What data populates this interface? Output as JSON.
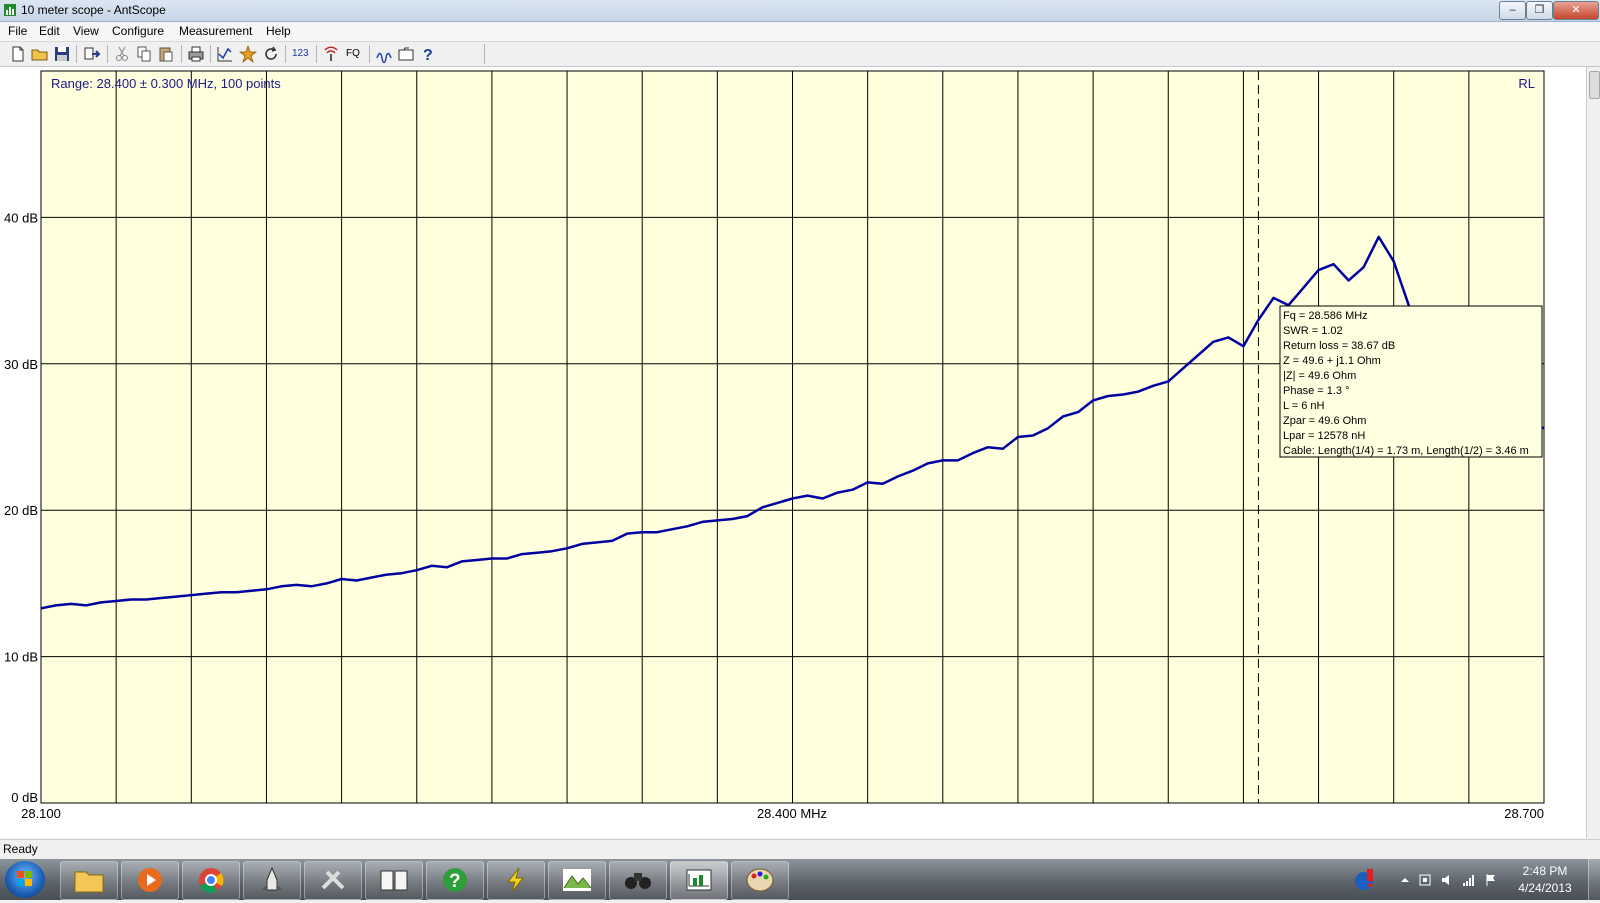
{
  "window": {
    "title": "10 meter scope - AntScope",
    "minimize_label": "–",
    "restore_label": "❐",
    "close_label": "✕"
  },
  "menu": [
    "File",
    "Edit",
    "View",
    "Configure",
    "Measurement",
    "Help"
  ],
  "toolbar": {
    "icons": [
      "new-file-icon",
      "open-folder-icon",
      "save-icon",
      "export-icon",
      "cut-icon",
      "copy-icon",
      "paste-icon",
      "print-icon",
      "graph-icon",
      "star-icon",
      "refresh-icon",
      "numbers-icon",
      "antenna-icon",
      "fq-icon",
      "smith-icon",
      "folder-tab-icon",
      "help-icon"
    ],
    "numbers_label": "123",
    "fq_label": "FQ"
  },
  "chart": {
    "range_text": "Range: 28.400 ± 0.300 MHz, 100 points",
    "mode_label": "RL",
    "x_center_label": "28.400 MHz",
    "x_left_label": "28.100",
    "x_right_label": "28.700",
    "plot_bg": "#ffffdd",
    "line_color": "#0000a0",
    "grid_color": "#000000",
    "tooltip_lines": [
      "Fq = 28.586 MHz",
      "SWR = 1.02",
      "Return loss = 38.67 dB",
      "Z = 49.6 + j1.1 Ohm",
      "|Z| = 49.6 Ohm",
      "Phase = 1.3 °",
      "L = 6 nH",
      "Zpar = 49.6 Ohm",
      "Lpar = 12578 nH",
      "Cable: Length(1/4) = 1.73 m, Length(1/2) = 3.46 m"
    ]
  },
  "chart_data": {
    "type": "line",
    "title": "Range: 28.400 ± 0.300 MHz, 100 points",
    "xlabel": "MHz",
    "ylabel": "dB",
    "xlim": [
      28.1,
      28.7
    ],
    "ylim": [
      0,
      50
    ],
    "y_ticks": [
      0,
      10,
      20,
      30,
      40
    ],
    "y_tick_labels": [
      "0 dB",
      "10 dB",
      "20 dB",
      "30 dB",
      "40 dB"
    ],
    "x_tick_labels": [
      "28.100",
      "28.400 MHz",
      "28.700"
    ],
    "x_gridlines": 20,
    "grid": true,
    "marker_x": 28.586,
    "series": [
      {
        "name": "RL",
        "x": [
          28.1,
          28.106,
          28.112,
          28.118,
          28.124,
          28.13,
          28.136,
          28.142,
          28.148,
          28.154,
          28.16,
          28.166,
          28.172,
          28.178,
          28.184,
          28.19,
          28.196,
          28.202,
          28.208,
          28.214,
          28.22,
          28.226,
          28.232,
          28.238,
          28.244,
          28.25,
          28.256,
          28.262,
          28.268,
          28.274,
          28.28,
          28.286,
          28.292,
          28.298,
          28.304,
          28.31,
          28.316,
          28.322,
          28.328,
          28.334,
          28.34,
          28.346,
          28.352,
          28.358,
          28.364,
          28.37,
          28.376,
          28.382,
          28.388,
          28.394,
          28.4,
          28.406,
          28.412,
          28.418,
          28.424,
          28.43,
          28.436,
          28.442,
          28.448,
          28.454,
          28.46,
          28.466,
          28.472,
          28.478,
          28.484,
          28.49,
          28.496,
          28.502,
          28.508,
          28.514,
          28.52,
          28.526,
          28.532,
          28.538,
          28.544,
          28.55,
          28.556,
          28.562,
          28.568,
          28.574,
          28.58,
          28.586,
          28.592,
          28.598,
          28.604,
          28.61,
          28.616,
          28.622,
          28.628,
          28.634,
          28.64,
          28.646,
          28.652,
          28.658,
          28.664,
          28.67,
          28.676,
          28.682,
          28.688,
          28.694,
          28.7
        ],
        "values": [
          13.3,
          13.5,
          13.6,
          13.5,
          13.7,
          13.8,
          13.9,
          13.9,
          14.0,
          14.1,
          14.2,
          14.3,
          14.4,
          14.4,
          14.5,
          14.6,
          14.8,
          14.9,
          14.8,
          15.0,
          15.3,
          15.2,
          15.4,
          15.6,
          15.7,
          15.9,
          16.2,
          16.1,
          16.5,
          16.6,
          16.7,
          16.7,
          17.0,
          17.1,
          17.2,
          17.4,
          17.7,
          17.8,
          17.9,
          18.4,
          18.5,
          18.5,
          18.7,
          18.9,
          19.2,
          19.3,
          19.4,
          19.6,
          20.2,
          20.5,
          20.8,
          21.0,
          20.8,
          21.2,
          21.4,
          21.9,
          21.8,
          22.3,
          22.7,
          23.2,
          23.4,
          23.4,
          23.9,
          24.3,
          24.2,
          25.0,
          25.1,
          25.6,
          26.4,
          26.7,
          27.5,
          27.8,
          27.9,
          28.1,
          28.5,
          28.8,
          29.7,
          30.6,
          31.5,
          31.8,
          31.2,
          33.0,
          34.5,
          34.0,
          35.2,
          36.4,
          36.8,
          35.7,
          36.6,
          38.67,
          37.0,
          34.0,
          31.5,
          29.5,
          28.0,
          27.2,
          26.8,
          26.5,
          26.2,
          25.9,
          25.6
        ]
      }
    ]
  },
  "status": {
    "text": "Ready"
  },
  "taskbar": {
    "apps": [
      "folder-icon",
      "media-player-icon",
      "chrome-icon",
      "shuttle-icon",
      "tools-icon",
      "book-icon",
      "help-circle-icon",
      "lightning-icon",
      "chart-app-icon",
      "binoculars-icon",
      "antscope-icon",
      "paint-icon"
    ],
    "time": "2:48 PM",
    "date": "4/24/2013"
  }
}
